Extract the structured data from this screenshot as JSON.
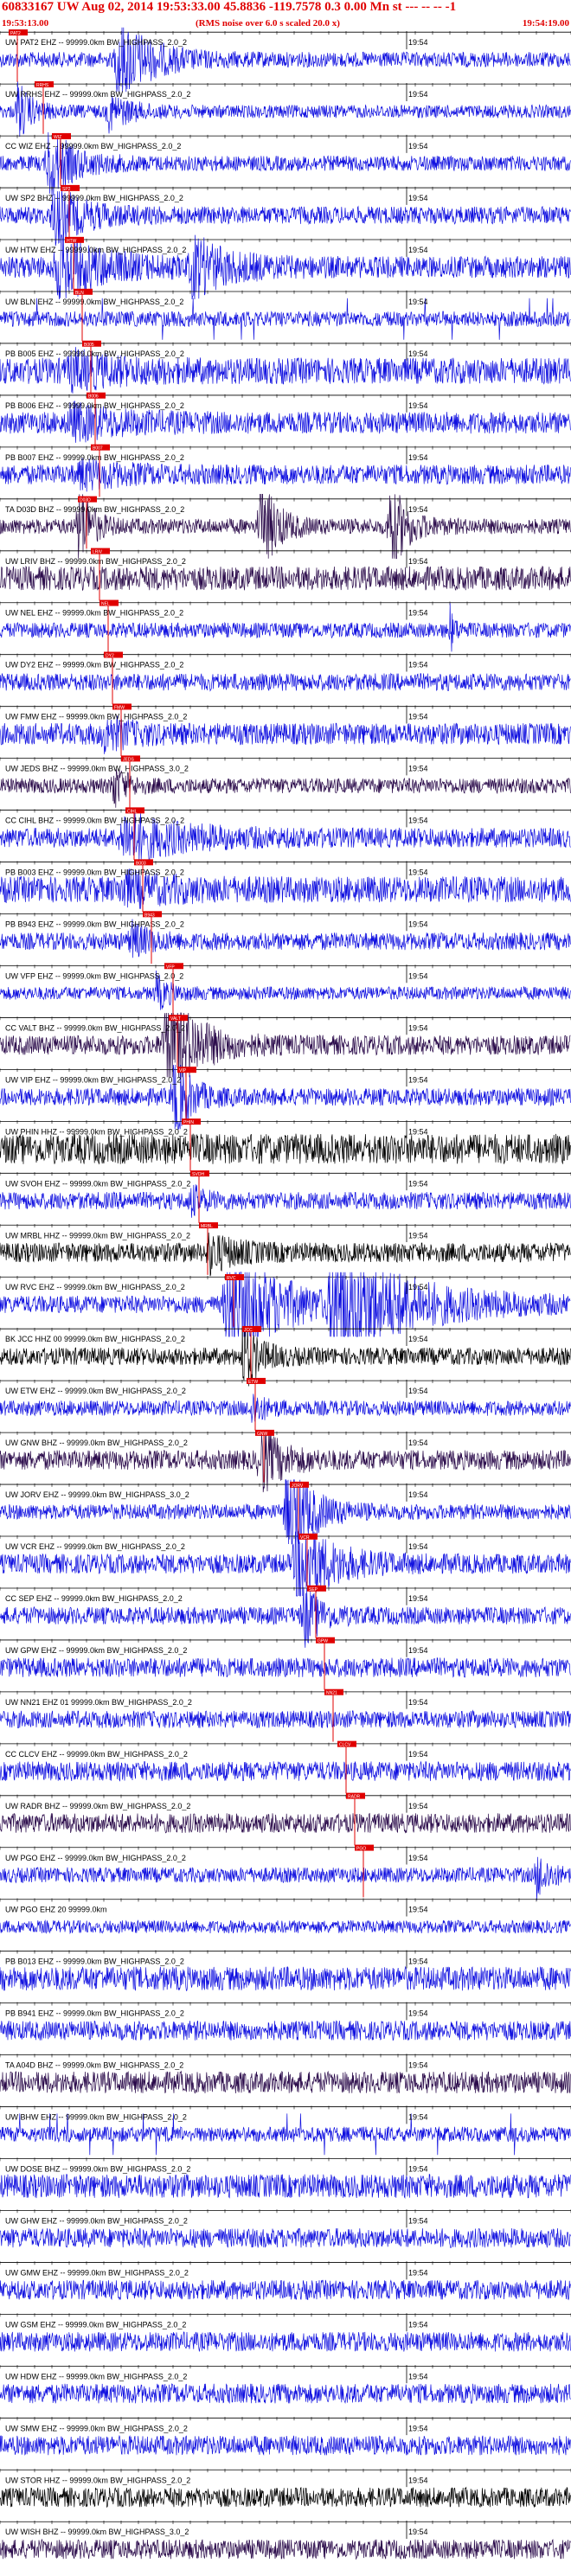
{
  "header": {
    "title": "60833167 UW Aug 02, 2014 19:53:33.00   45.8836 -119.7578  0.3 0.00 Mn st --- -- -- -1",
    "start_time": "19:53:13.00",
    "noise_note": "(RMS noise over 6.0 s scaled 20.0 x)",
    "end_time": "19:54:19.00"
  },
  "chart_data": {
    "type": "line",
    "title": "",
    "x_range_seconds": [
      0,
      66
    ],
    "time_tick_label": "19:54",
    "time_tick_offset_s": 47,
    "colors": {
      "blue": "#1010e0",
      "dark": "#2a0a4a",
      "black": "#000000",
      "pick": "#e00000"
    },
    "traces": [
      {
        "label": "UW PAT2 EHZ -- 99999.0km BW_HIGHPASS_2.0_2",
        "color": "blue",
        "amp": 0.35,
        "events": [
          [
            13.4,
            8,
            2.0
          ]
        ]
      },
      {
        "label": "UW RRHS EHZ -- 99999.0km BW_HIGHPASS_2.0_2",
        "color": "blue",
        "amp": 0.3,
        "events": [
          [
            2.0,
            3,
            1.4
          ],
          [
            12.5,
            5,
            0.8
          ]
        ]
      },
      {
        "label": "CC WIZ EHZ -- 99999.0km BW_HIGHPASS_2.0_2",
        "color": "blue",
        "amp": 0.35,
        "events": [
          [
            5.5,
            6,
            1.6
          ]
        ]
      },
      {
        "label": "UW SP2 BHZ -- 99999.0km BW_HIGHPASS_2.0_2",
        "color": "blue",
        "amp": 0.4,
        "events": [
          [
            6.0,
            8,
            1.2
          ]
        ]
      },
      {
        "label": "UW HTW EHZ -- 99999.0km BW_HIGHPASS_2.0_2",
        "color": "blue",
        "amp": 0.5,
        "events": [
          [
            6.5,
            10,
            1.5
          ],
          [
            22.0,
            8,
            1.3
          ]
        ]
      },
      {
        "label": "UW BLN EHZ -- 99999.0km BW_HIGHPASS_2.0_2",
        "color": "blue",
        "amp": 0.35,
        "events": [],
        "spikes": true
      },
      {
        "label": "PB B005 EHZ -- 99999.0km BW_HIGHPASS_2.0_2",
        "color": "blue",
        "amp": 0.6,
        "events": [
          [
            8,
            10,
            0.6
          ]
        ]
      },
      {
        "label": "PB B006 EHZ -- 99999.0km BW_HIGHPASS_2.0_2",
        "color": "blue",
        "amp": 0.5,
        "events": [
          [
            8,
            12,
            0.6
          ]
        ]
      },
      {
        "label": "PB B007 EHZ -- 99999.0km BW_HIGHPASS_2.0_2",
        "color": "blue",
        "amp": 0.45,
        "events": [
          [
            9,
            10,
            0.5
          ]
        ]
      },
      {
        "label": "TA D03D BHZ -- 99999.0km BW_HIGHPASS_2.0_2",
        "color": "dark",
        "amp": 0.35,
        "events": [
          [
            9,
            3,
            2.2
          ],
          [
            30,
            4,
            2.4
          ],
          [
            45,
            4,
            2.2
          ]
        ]
      },
      {
        "label": "UW LRIV BHZ -- 99999.0km BW_HIGHPASS_2.0_2",
        "color": "dark",
        "amp": 0.55,
        "events": []
      },
      {
        "label": "UW NEL EHZ -- 99999.0km BW_HIGHPASS_2.0_2",
        "color": "blue",
        "amp": 0.35,
        "events": [
          [
            52,
            1,
            1.0
          ]
        ]
      },
      {
        "label": "UW DY2 EHZ -- 99999.0km BW_HIGHPASS_2.0_2",
        "color": "blue",
        "amp": 0.4,
        "events": []
      },
      {
        "label": "UW FMW EHZ -- 99999.0km BW_HIGHPASS_2.0_2",
        "color": "blue",
        "amp": 0.5,
        "events": [
          [
            12,
            6,
            0.6
          ]
        ]
      },
      {
        "label": "UW JEDS BHZ -- 99999.0km BW_HIGHPASS_3.0_2",
        "color": "dark",
        "amp": 0.35,
        "events": [
          [
            13,
            3,
            1.0
          ]
        ]
      },
      {
        "label": "CC CIHL BHZ -- 99999.0km BW_HIGHPASS_2.0_2",
        "color": "blue",
        "amp": 0.45,
        "events": [
          [
            14,
            14,
            1.0
          ]
        ]
      },
      {
        "label": "PB B003 EHZ -- 99999.0km BW_HIGHPASS_2.0_2",
        "color": "blue",
        "amp": 0.6,
        "events": [
          [
            14,
            10,
            0.5
          ]
        ]
      },
      {
        "label": "PB B943 EHZ -- 99999.0km BW_HIGHPASS_2.0_2",
        "color": "blue",
        "amp": 0.4,
        "events": [
          [
            15,
            4,
            0.8
          ]
        ]
      },
      {
        "label": "UW VFP EHZ -- 99999.0km BW_HIGHPASS_2.0_2",
        "color": "blue",
        "amp": 0.3,
        "events": [
          [
            18,
            3,
            0.8
          ]
        ]
      },
      {
        "label": "CC VALT BHZ -- 99999.0km BW_HIGHPASS_2.0_2",
        "color": "dark",
        "amp": 0.45,
        "events": [
          [
            19,
            7,
            3.0
          ]
        ]
      },
      {
        "label": "UW VIP EHZ -- 99999.0km BW_HIGHPASS_2.0_2",
        "color": "blue",
        "amp": 0.4,
        "events": [
          [
            20,
            4,
            2.0
          ]
        ]
      },
      {
        "label": "UW PHIN HHZ -- 99999.0km BW_HIGHPASS_2.0_2",
        "color": "black",
        "amp": 0.7,
        "events": []
      },
      {
        "label": "UW SVOH EHZ -- 99999.0km BW_HIGHPASS_2.0_2",
        "color": "blue",
        "amp": 0.4,
        "events": [
          [
            22,
            3,
            0.6
          ]
        ]
      },
      {
        "label": "UW MRBL HHZ -- 99999.0km BW_HIGHPASS_2.0_2",
        "color": "black",
        "amp": 0.45,
        "events": [
          [
            24,
            6,
            0.8
          ]
        ]
      },
      {
        "label": "UW RVC EHZ -- 99999.0km BW_HIGHPASS_2.0_2",
        "color": "blue",
        "amp": 0.4,
        "events": [
          [
            26,
            12,
            3.0
          ],
          [
            38,
            18,
            2.8
          ]
        ]
      },
      {
        "label": "BK JCC HHZ 00 99999.0km BW_HIGHPASS_2.0_2",
        "color": "black",
        "amp": 0.4,
        "events": [
          [
            28,
            4,
            1.5
          ]
        ]
      },
      {
        "label": "UW ETW EHZ -- 99999.0km BW_HIGHPASS_2.0_2",
        "color": "blue",
        "amp": 0.35,
        "events": [
          [
            29,
            3,
            0.7
          ]
        ]
      },
      {
        "label": "UW GNW BHZ -- 99999.0km BW_HIGHPASS_2.0_2",
        "color": "dark",
        "amp": 0.45,
        "events": [
          [
            30,
            5,
            1.5
          ]
        ]
      },
      {
        "label": "UW JORV EHZ -- 99999.0km BW_HIGHPASS_3.0_2",
        "color": "blue",
        "amp": 0.35,
        "events": [
          [
            33,
            6,
            2.6
          ]
        ]
      },
      {
        "label": "UW VCR EHZ -- 99999.0km BW_HIGHPASS_2.0_2",
        "color": "blue",
        "amp": 0.45,
        "events": [
          [
            34,
            8,
            2.2
          ]
        ]
      },
      {
        "label": "CC SEP EHZ -- 99999.0km BW_HIGHPASS_2.0_2",
        "color": "blue",
        "amp": 0.4,
        "events": [
          [
            35,
            4,
            1.4
          ]
        ]
      },
      {
        "label": "UW GPW EHZ -- 99999.0km BW_HIGHPASS_2.0_2",
        "color": "blue",
        "amp": 0.45,
        "events": []
      },
      {
        "label": "UW NN21 EHZ 01 99999.0km BW_HIGHPASS_2.0_2",
        "color": "blue",
        "amp": 0.4,
        "events": []
      },
      {
        "label": "CC CLCV EHZ -- 99999.0km BW_HIGHPASS_2.0_2",
        "color": "blue",
        "amp": 0.45,
        "events": []
      },
      {
        "label": "UW RADR BHZ -- 99999.0km BW_HIGHPASS_2.0_2",
        "color": "dark",
        "amp": 0.45,
        "events": []
      },
      {
        "label": "UW PGO EHZ -- 99999.0km BW_HIGHPASS_2.0_2",
        "color": "blue",
        "amp": 0.35,
        "events": [
          [
            62,
            3,
            1.0
          ]
        ]
      },
      {
        "label": "UW PGO EHZ 20 99999.0km",
        "color": "blue",
        "amp": 0.3,
        "events": []
      },
      {
        "label": "PB B013 EHZ -- 99999.0km BW_HIGHPASS_2.0_2",
        "color": "blue",
        "amp": 0.55,
        "events": []
      },
      {
        "label": "PB B941 EHZ -- 99999.0km BW_HIGHPASS_2.0_2",
        "color": "blue",
        "amp": 0.45,
        "events": []
      },
      {
        "label": "TA A04D BHZ -- 99999.0km BW_HIGHPASS_2.0_2",
        "color": "dark",
        "amp": 0.5,
        "events": []
      },
      {
        "label": "UW BHW EHZ -- 99999.0km BW_HIGHPASS_2.0_2",
        "color": "blue",
        "amp": 0.35,
        "events": [],
        "spikes": true
      },
      {
        "label": "UW DOSE BHZ -- 99999.0km BW_HIGHPASS_2.0_2",
        "color": "blue",
        "amp": 0.55,
        "events": []
      },
      {
        "label": "UW GHW EHZ -- 99999.0km BW_HIGHPASS_2.0_2",
        "color": "blue",
        "amp": 0.45,
        "events": []
      },
      {
        "label": "UW GMW EHZ -- 99999.0km BW_HIGHPASS_2.0_2",
        "color": "blue",
        "amp": 0.45,
        "events": []
      },
      {
        "label": "UW GSM EHZ -- 99999.0km BW_HIGHPASS_2.0_2",
        "color": "blue",
        "amp": 0.45,
        "events": []
      },
      {
        "label": "UW HDW EHZ -- 99999.0km BW_HIGHPASS_2.0_2",
        "color": "blue",
        "amp": 0.45,
        "events": []
      },
      {
        "label": "UW SMW EHZ -- 99999.0km BW_HIGHPASS_2.0_2",
        "color": "blue",
        "amp": 0.45,
        "events": []
      },
      {
        "label": "UW STOR HHZ -- 99999.0km BW_HIGHPASS_2.0_2",
        "color": "black",
        "amp": 0.45,
        "events": []
      },
      {
        "label": "UW WISH BHZ -- 99999.0km BW_HIGHPASS_3.0_2",
        "color": "dark",
        "amp": 0.45,
        "events": []
      }
    ],
    "picks": [
      {
        "label": "PAT2",
        "time_s": 1.0
      },
      {
        "label": "RRHS",
        "time_s": 4.0
      },
      {
        "label": "WIZ",
        "time_s": 6.0
      },
      {
        "label": "SP2",
        "time_s": 7.0
      },
      {
        "label": "HTW",
        "time_s": 7.5
      },
      {
        "label": "BLN",
        "time_s": 8.5
      },
      {
        "label": "B005",
        "time_s": 9.5
      },
      {
        "label": "B006",
        "time_s": 10.0
      },
      {
        "label": "B007",
        "time_s": 10.5
      },
      {
        "label": "D03D",
        "time_s": 9.0
      },
      {
        "label": "LRIV",
        "time_s": 10.5
      },
      {
        "label": "NEL",
        "time_s": 11.5
      },
      {
        "label": "DY2",
        "time_s": 12.0
      },
      {
        "label": "FMW",
        "time_s": 13.0
      },
      {
        "label": "JEDS",
        "time_s": 14.0
      },
      {
        "label": "CIHL",
        "time_s": 14.5
      },
      {
        "label": "B003",
        "time_s": 15.5
      },
      {
        "label": "B943",
        "time_s": 16.5
      },
      {
        "label": "VFP",
        "time_s": 19.0
      },
      {
        "label": "VALT",
        "time_s": 19.5
      },
      {
        "label": "VIP",
        "time_s": 20.5
      },
      {
        "label": "PHIN",
        "time_s": 21.0
      },
      {
        "label": "SVOH",
        "time_s": 22.0
      },
      {
        "label": "MRBL",
        "time_s": 23.0
      },
      {
        "label": "RVC",
        "time_s": 26.0
      },
      {
        "label": "JCC",
        "time_s": 28.0
      },
      {
        "label": "ETW",
        "time_s": 28.5
      },
      {
        "label": "GNW",
        "time_s": 29.5
      },
      {
        "label": "JORV",
        "time_s": 33.5
      },
      {
        "label": "VCR",
        "time_s": 34.5
      },
      {
        "label": "SEP",
        "time_s": 35.5
      },
      {
        "label": "GPW",
        "time_s": 36.5
      },
      {
        "label": "NN21",
        "time_s": 37.5
      },
      {
        "label": "CLCV",
        "time_s": 39.0
      },
      {
        "label": "RADR",
        "time_s": 40.0
      },
      {
        "label": "PGO",
        "time_s": 41.0
      }
    ]
  }
}
